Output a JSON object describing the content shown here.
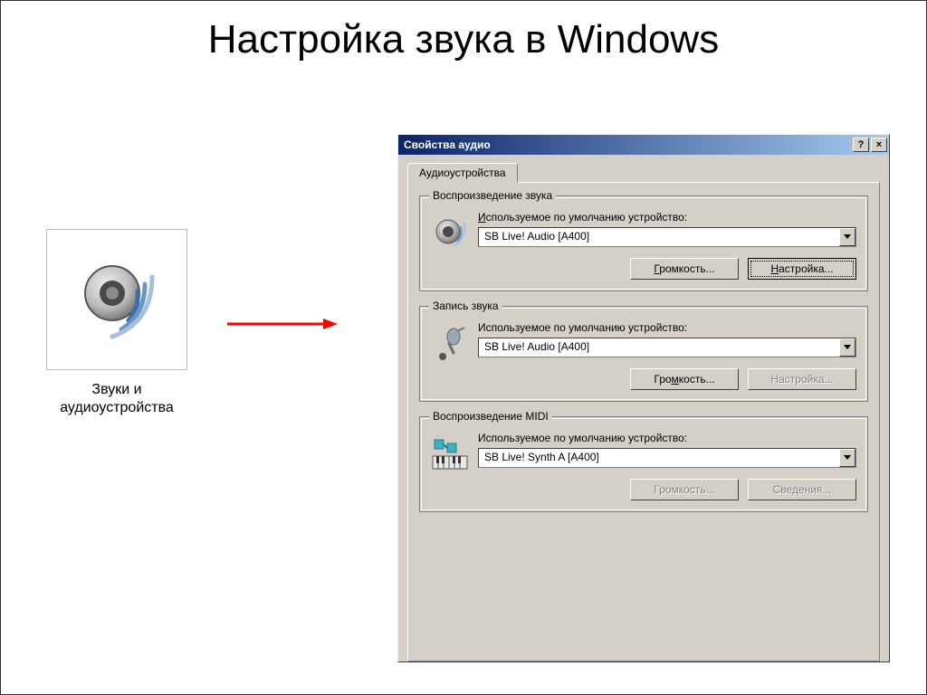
{
  "slide": {
    "title": "Настройка звука в Windows"
  },
  "cp_icon": {
    "caption": "Звуки и аудиоустройства"
  },
  "dialog": {
    "title": "Свойства аудио",
    "help_symbol": "?",
    "close_symbol": "×",
    "tab": "Аудиоустройства",
    "playback": {
      "legend": "Воспроизведение звука",
      "label": "Используемое по умолчанию устройство:",
      "underline_char": "И",
      "device": "SB Live! Audio [A400]",
      "volume_btn": "Громкость...",
      "volume_u": "Г",
      "setup_btn": "Настройка...",
      "setup_u": "Н"
    },
    "record": {
      "legend": "Запись звука",
      "label": "Используемое по умолчанию устройство:",
      "device": "SB Live! Audio [A400]",
      "volume_btn": "Громкость...",
      "volume_u": "м",
      "setup_btn": "Настройка..."
    },
    "midi": {
      "legend": "Воспроизведение MIDI",
      "label": "Используемое по умолчанию устройство:",
      "device": "SB Live! Synth A [A400]",
      "volume_btn": "Громкость...",
      "info_btn": "Сведения..."
    }
  }
}
